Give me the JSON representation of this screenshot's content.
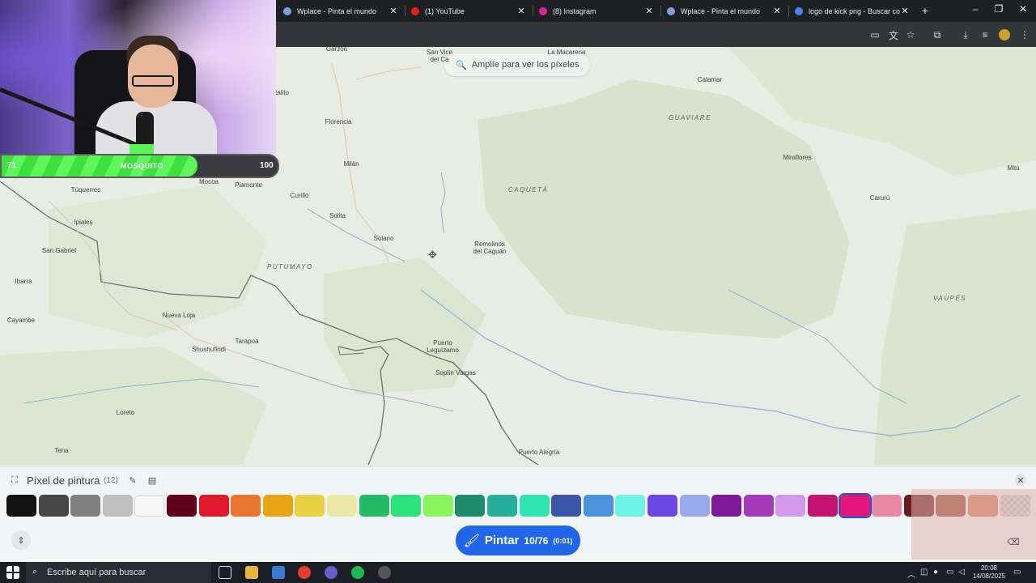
{
  "browser": {
    "tabs": [
      {
        "title": "Wplace - Pinta el mundo",
        "icon": "globe-icon",
        "color": "#7aa3d6"
      },
      {
        "title": "(1) YouTube",
        "icon": "youtube-icon",
        "color": "#e62117"
      },
      {
        "title": "(8) Instagram",
        "icon": "instagram-icon",
        "color": "#d6249f"
      },
      {
        "title": "Wplace - Pinta el mundo",
        "icon": "globe-icon",
        "color": "#7aa3d6"
      },
      {
        "title": "logo de kick png - Buscar con G",
        "icon": "google-icon",
        "color": "#4285f4"
      }
    ],
    "new_tab": "+",
    "window_controls": [
      "–",
      "❐",
      "✕"
    ]
  },
  "stream": {
    "xp_current": "71",
    "xp_max": "100",
    "xp_fraction": 0.71,
    "label": "MOSQUITO"
  },
  "map": {
    "zoom_hint": "Amplíe para ver los píxeles",
    "places": [
      {
        "name": "Garzón"
      },
      {
        "name": "San Vice\ndel Ca"
      },
      {
        "name": "La Macarena"
      },
      {
        "name": "Calamar"
      },
      {
        "name": "Pitalito"
      },
      {
        "name": "Florencia"
      },
      {
        "name": "Milán"
      },
      {
        "name": "Miraflores"
      },
      {
        "name": "Mitú"
      },
      {
        "name": "Carurú"
      },
      {
        "name": "Mocoa"
      },
      {
        "name": "Piamonte"
      },
      {
        "name": "Túquerres"
      },
      {
        "name": "Curillo"
      },
      {
        "name": "Solita"
      },
      {
        "name": "Ipiales"
      },
      {
        "name": "Solano"
      },
      {
        "name": "Remolinos\ndel Caguán"
      },
      {
        "name": "San Gabriel"
      },
      {
        "name": "Ibarra"
      },
      {
        "name": "Cayambe"
      },
      {
        "name": "Nueva Loja"
      },
      {
        "name": "Tarapoa"
      },
      {
        "name": "Shushufindi"
      },
      {
        "name": "Puerto\nLeguízamo"
      },
      {
        "name": "Soplín Vargas"
      },
      {
        "name": "Loreto"
      },
      {
        "name": "Tena"
      },
      {
        "name": "Puerto Alegría"
      }
    ],
    "regions": [
      "GUAVIARE",
      "CAQUETÁ",
      "PUTUMAYO",
      "VAUPÉS"
    ]
  },
  "paint_panel": {
    "title": "Píxel de pintura",
    "count": "(12)",
    "button_label": "Pintar",
    "charges": "10/76",
    "timer": "(0:01)",
    "colors": [
      "#111111",
      "#474747",
      "#808080",
      "#bfbfbf",
      "#f6f6f6",
      "#600018",
      "#e0192b",
      "#ea7530",
      "#e7a614",
      "#e8d244",
      "#ece9a8",
      "#23bb65",
      "#2ae47b",
      "#89f45d",
      "#1c8a6c",
      "#25ae9c",
      "#2ee6b3",
      "#3a56a5",
      "#4c93dc",
      "#70f1e6",
      "#6d47e1",
      "#99aaec",
      "#7b1a9a",
      "#a53bb8",
      "#d29ae7",
      "#c1136f",
      "#e0187a",
      "#e78aa6",
      "#6b1c1c",
      "#99462a",
      "#d87a52",
      "#c9c0c0"
    ],
    "selected_index": 26
  },
  "taskbar": {
    "search_placeholder": "Escribe aquí para buscar",
    "time": "20:08",
    "date": "14/08/2025"
  }
}
